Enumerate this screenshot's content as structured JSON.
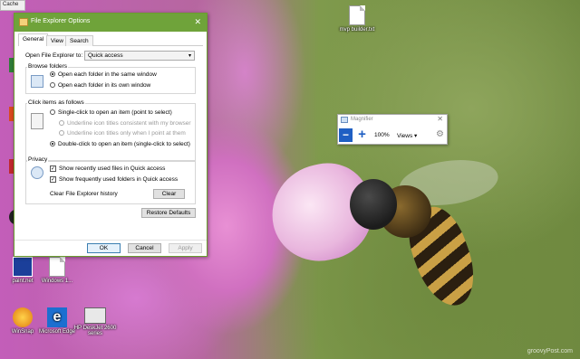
{
  "desktop": {
    "corner_label": "Cache",
    "icons": [
      {
        "label": "mvp builder.txt",
        "glyph": "text-file-icon"
      },
      {
        "label": "paint.net",
        "glyph": "paint-icon"
      },
      {
        "label": "Windows 1...",
        "glyph": "blank-file-icon"
      },
      {
        "label": "WinSnap",
        "glyph": "winsnap-icon"
      },
      {
        "label": "Microsoft Edge",
        "glyph": "edge-icon"
      },
      {
        "label": "HP DeskJet 2600 series",
        "glyph": "printer-icon"
      }
    ],
    "watermark": "groovyPost.com"
  },
  "dialog": {
    "title": "File Explorer Options",
    "close_glyph": "✕",
    "tabs": [
      "General",
      "View",
      "Search"
    ],
    "open_label": "Open File Explorer to:",
    "open_value": "Quick access",
    "browse_folders": {
      "label": "Browse folders",
      "options": [
        "Open each folder in the same window",
        "Open each folder in its own window"
      ]
    },
    "click_items": {
      "label": "Click items as follows",
      "single": "Single-click to open an item (point to select)",
      "underline_consistent": "Underline icon titles consistent with my browser",
      "underline_point": "Underline icon titles only when I point at them",
      "double": "Double-click to open an item (single-click to select)"
    },
    "privacy": {
      "label": "Privacy",
      "recent_files": "Show recently used files in Quick access",
      "frequent_folders": "Show frequently used folders in Quick access",
      "clear_history": "Clear File Explorer history",
      "clear_button": "Clear"
    },
    "restore_button": "Restore Defaults",
    "ok": "OK",
    "cancel": "Cancel",
    "apply": "Apply"
  },
  "magnifier": {
    "title": "Magnifier",
    "minus": "−",
    "plus": "+",
    "zoom": "100%",
    "views": "Views ▾",
    "close_glyph": "✕"
  }
}
